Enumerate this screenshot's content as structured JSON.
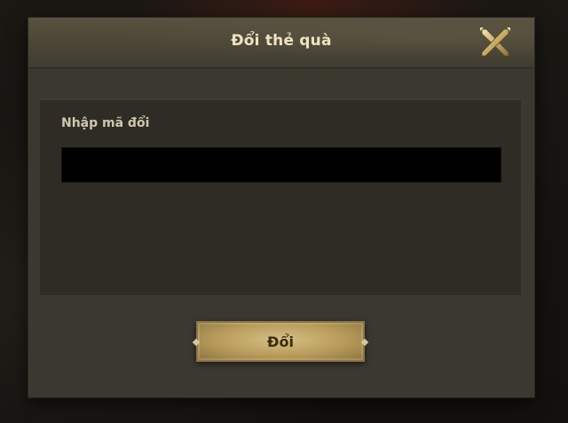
{
  "dialog": {
    "title": "Đổi thẻ quà",
    "close_icon": "close-x-icon",
    "field_label": "Nhập mã đổi",
    "input_value": "",
    "input_placeholder": "",
    "submit_label": "Đổi"
  },
  "colors": {
    "title_text": "#efe2c2",
    "button_gold": "#c8ad6e",
    "input_bg": "#000000",
    "panel_bg": "#2f2c25"
  }
}
